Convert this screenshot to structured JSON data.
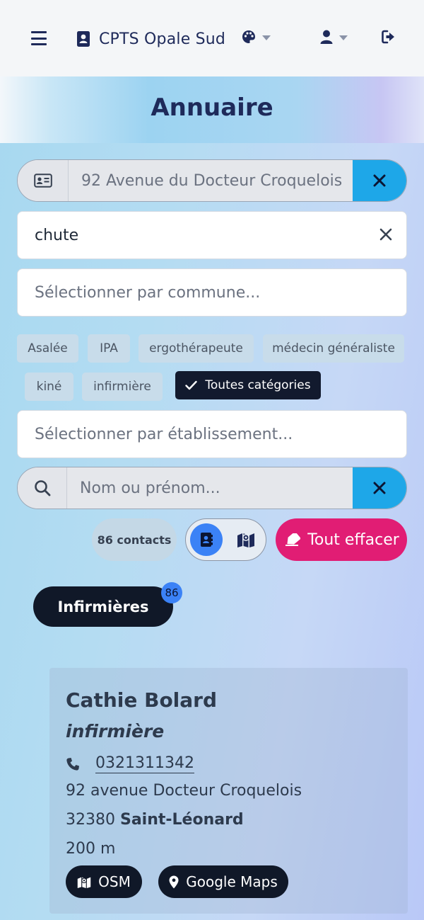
{
  "navbar": {
    "brand": "CPTS Opale Sud",
    "icons": [
      "menu-icon",
      "address-card-icon",
      "palette-icon",
      "user-icon",
      "logout-icon"
    ]
  },
  "page": {
    "title": "Annuaire"
  },
  "address_filter": {
    "value": "92 Avenue du Docteur Croquelois"
  },
  "keyword_filter": {
    "value": "chute"
  },
  "commune_filter": {
    "placeholder": "Sélectionner par commune..."
  },
  "categories": [
    {
      "label": "Asalée",
      "active": false
    },
    {
      "label": "IPA",
      "active": false
    },
    {
      "label": "ergothérapeute",
      "active": false
    },
    {
      "label": "médecin généraliste",
      "active": false
    },
    {
      "label": "kiné",
      "active": false
    },
    {
      "label": "infirmière",
      "active": false
    },
    {
      "label": "Toutes catégories",
      "active": true
    }
  ],
  "establishment_filter": {
    "placeholder": "Sélectionner par établissement..."
  },
  "name_search": {
    "placeholder": "Nom ou prénom..."
  },
  "controls": {
    "count_label": "86 contacts",
    "clear_all_label": "Tout effacer"
  },
  "group": {
    "label": "Infirmières",
    "badge": "86"
  },
  "contact": {
    "name": "Cathie Bolard",
    "role": "infirmière",
    "phone": "0321311342",
    "address": "92 avenue Docteur Croquelois",
    "postal_code": "32380",
    "city": "Saint-Léonard",
    "distance": "200 m",
    "osm_label": "OSM",
    "gmaps_label": "Google Maps"
  },
  "colors": {
    "navy": "#1e2a5a",
    "accent_blue": "#1ea7e8",
    "toggle_blue": "#3b82f6",
    "pink": "#e11d74",
    "dark": "#101828"
  }
}
